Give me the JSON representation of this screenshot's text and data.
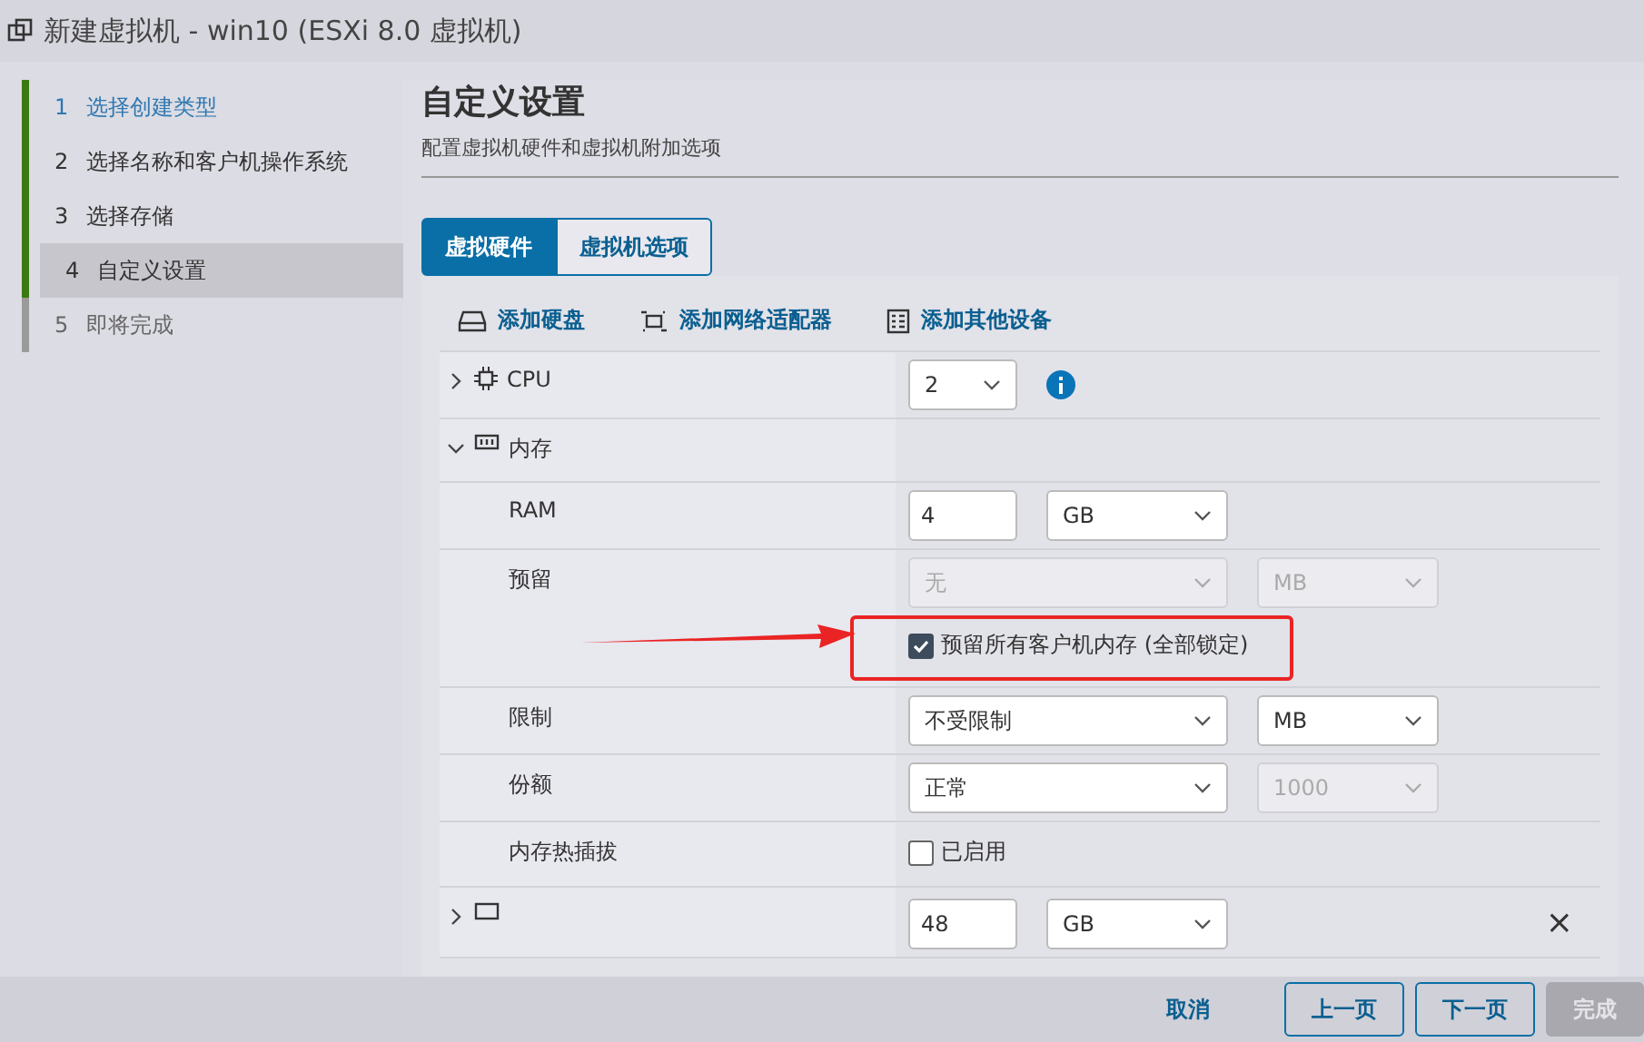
{
  "window": {
    "title": "新建虚拟机 - win10 (ESXi 8.0 虚拟机)"
  },
  "steps": [
    {
      "number": "1",
      "label": "选择创建类型",
      "completed": true,
      "selected": false,
      "linked": true
    },
    {
      "number": "2",
      "label": "选择名称和客户机操作系统",
      "completed": true,
      "selected": false,
      "linked": false
    },
    {
      "number": "3",
      "label": "选择存储",
      "completed": true,
      "selected": false,
      "linked": false
    },
    {
      "number": "4",
      "label": "自定义设置",
      "completed": true,
      "selected": true,
      "linked": false
    },
    {
      "number": "5",
      "label": "即将完成",
      "completed": false,
      "selected": false,
      "linked": false
    }
  ],
  "page": {
    "title": "自定义设置",
    "subtitle": "配置虚拟机硬件和虚拟机附加选项"
  },
  "tabs": [
    {
      "label": "虚拟硬件",
      "selected": true
    },
    {
      "label": "虚拟机选项",
      "selected": false
    }
  ],
  "toolbar": [
    {
      "kind": "disk",
      "label": "添加硬盘"
    },
    {
      "kind": "network",
      "label": "添加网络适配器"
    },
    {
      "kind": "device",
      "label": "添加其他设备"
    }
  ],
  "hardware": [
    {
      "kind": "cpu",
      "label": "CPU",
      "expanded": false,
      "controls": [
        {
          "kind": "select",
          "value": "2",
          "disabled": false
        },
        {
          "kind": "info"
        }
      ]
    },
    {
      "kind": "memory",
      "label": "内存",
      "expanded": true,
      "children": [
        {
          "label": "RAM",
          "controls": [
            {
              "kind": "input",
              "value": "4"
            },
            {
              "kind": "select",
              "value": "GB",
              "disabled": false
            }
          ]
        },
        {
          "label": "预留",
          "controls": [
            {
              "kind": "select",
              "value": "无",
              "disabled": true
            },
            {
              "kind": "select",
              "value": "MB",
              "disabled": true
            },
            {
              "kind": "checkbox",
              "label": "预留所有客户机内存 (全部锁定)",
              "checked": true,
              "annotated": true
            }
          ]
        },
        {
          "label": "限制",
          "controls": [
            {
              "kind": "select",
              "value": "不受限制",
              "disabled": false
            },
            {
              "kind": "select",
              "value": "MB",
              "disabled": false
            }
          ]
        },
        {
          "label": "份额",
          "controls": [
            {
              "kind": "select",
              "value": "正常",
              "disabled": false
            },
            {
              "kind": "select",
              "value": "1000",
              "disabled": true
            }
          ]
        },
        {
          "label": "内存热插拔",
          "controls": [
            {
              "kind": "checkbox",
              "label": "已启用",
              "checked": false,
              "annotated": false
            }
          ]
        }
      ]
    },
    {
      "kind": "disk",
      "expanded": false,
      "controls": [
        {
          "kind": "input",
          "value": "48"
        },
        {
          "kind": "select",
          "value": "GB",
          "disabled": false
        },
        {
          "kind": "remove",
          "label": "×"
        }
      ]
    }
  ],
  "footer": [
    {
      "kind": "flat",
      "label": "取消",
      "disabled": false
    },
    {
      "kind": "outline",
      "label": "上一页",
      "disabled": false
    },
    {
      "kind": "outline",
      "label": "下一页",
      "disabled": false
    },
    {
      "kind": "outline",
      "label": "完成",
      "disabled": true
    }
  ]
}
